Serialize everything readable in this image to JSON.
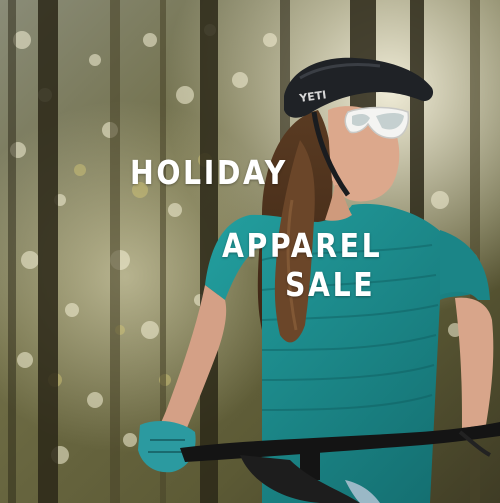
{
  "promo": {
    "headline_line1": "HOLIDAY",
    "headline_line2": "APPAREL",
    "headline_line3": "SALE",
    "helmet_brand": "YETI"
  },
  "colors": {
    "text": "#ffffff",
    "jersey": "#1d8a8c",
    "helmet": "#1f2226",
    "forest_light": "#f2f0d8",
    "forest_dark": "#2f2b1c"
  }
}
